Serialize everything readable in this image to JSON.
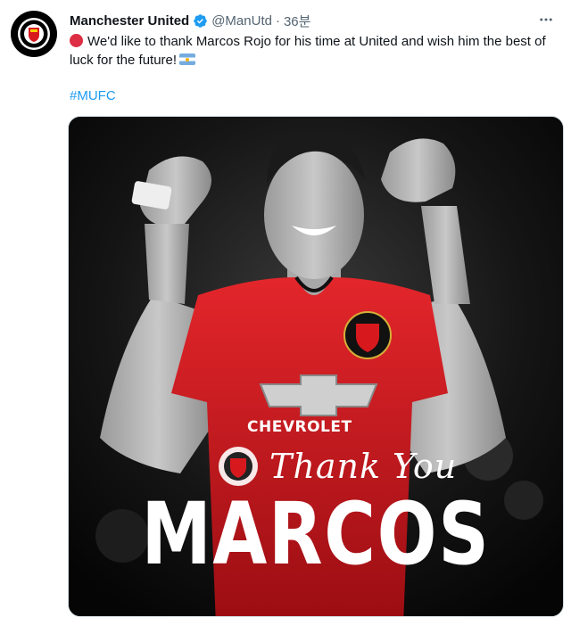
{
  "tweet": {
    "author_name": "Manchester United",
    "handle": "@ManUtd",
    "separator": "·",
    "time": "36분",
    "text": "We'd like to thank Marcos Rojo for his time at United and wish him the best of luck for the future!",
    "hashtag": "#MUFC",
    "icons": {
      "verified": "verified-badge-icon",
      "more": "more-options-icon",
      "red_circle": "red-circle-emoji",
      "flag": "argentina-flag-emoji"
    },
    "colors": {
      "link": "#1d9bf0",
      "secondary_text": "#536471",
      "primary_text": "#0f1419",
      "shirt_red": "#d7191e"
    }
  },
  "image": {
    "sponsor": "CHEVROLET",
    "tagline": "Thank You",
    "player_name": "MARCOS"
  }
}
